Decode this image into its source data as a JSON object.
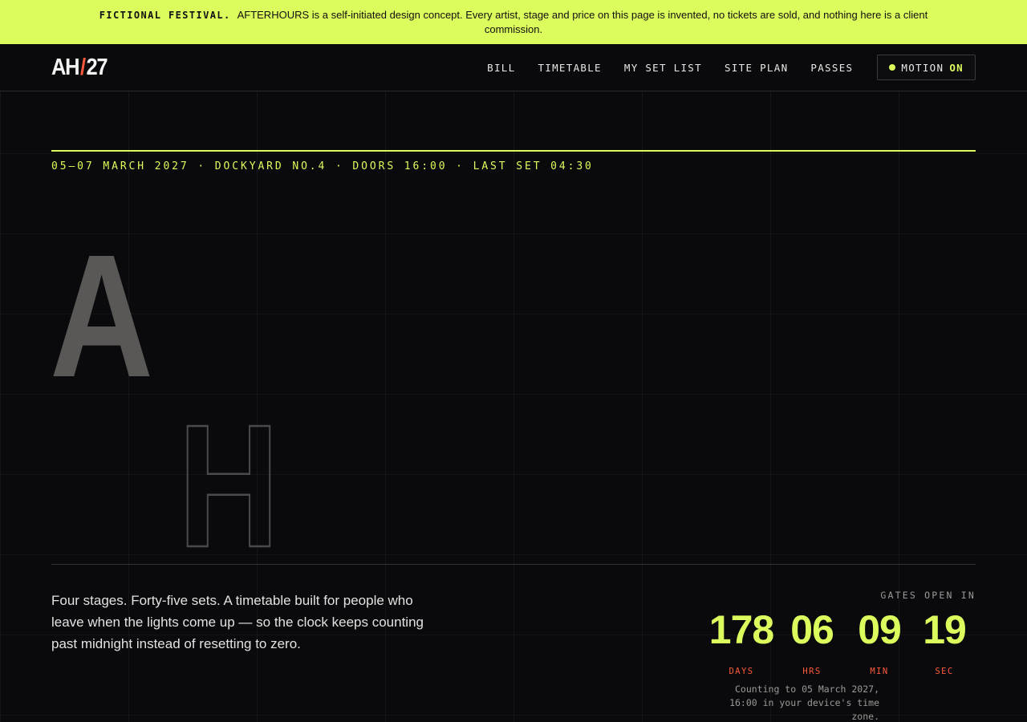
{
  "banner": {
    "tag": "FICTIONAL FESTIVAL.",
    "text": "AFTERHOURS is a self-initiated design concept. Every artist, stage and price on this page is invented, no tickets are sold, and nothing here is a client commission."
  },
  "nav": {
    "logo_left": "AH",
    "logo_slash": "/",
    "logo_right": "27",
    "items": [
      {
        "label": "BILL"
      },
      {
        "label": "TIMETABLE"
      },
      {
        "label": "MY SET LIST"
      },
      {
        "label": "SITE PLAN"
      },
      {
        "label": "PASSES"
      }
    ],
    "motion": {
      "label": "MOTION",
      "state": "ON"
    }
  },
  "hero": {
    "meta": "05–07 MARCH 2027 · DOCKYARD NO.4 · DOORS 16:00 · LAST SET 04:30",
    "letter_a": "A",
    "letter_h": "H",
    "intro": "Four stages. Forty-five sets. A timetable built for people who leave when the lights come up — so the clock keeps counting past midnight instead of resetting to zero."
  },
  "countdown": {
    "label": "GATES OPEN IN",
    "units": [
      {
        "value": "178",
        "label": "DAYS"
      },
      {
        "value": "06",
        "label": "HRS"
      },
      {
        "value": "09",
        "label": "MIN"
      },
      {
        "value": "19",
        "label": "SEC"
      }
    ],
    "note": "Counting to 05 March 2027, 16:00 in your device's time zone."
  },
  "colors": {
    "accent": "#dcfb5c",
    "alert": "#ff5a3c",
    "background": "#0a0a0c"
  }
}
